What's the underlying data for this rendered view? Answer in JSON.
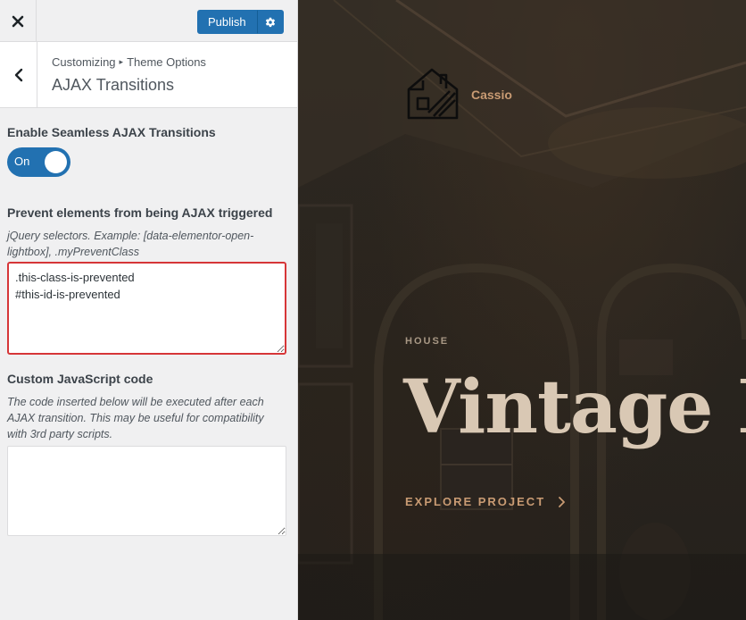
{
  "topbar": {
    "close_icon": "close-icon",
    "publish_label": "Publish",
    "settings_icon": "gear-icon"
  },
  "section": {
    "back_icon": "chevron-left-icon",
    "breadcrumb": [
      "Customizing",
      "Theme Options"
    ],
    "title": "AJAX Transitions"
  },
  "controls": {
    "enable_ajax": {
      "title": "Enable Seamless AJAX Transitions",
      "state_label": "On",
      "checked": true
    },
    "prevent": {
      "title": "Prevent elements from being AJAX triggered",
      "description": "jQuery selectors. Example: [data-elementor-open-lightbox], .myPreventClass",
      "value": ".this-class-is-prevented\n#this-id-is-prevented"
    },
    "custom_js": {
      "title": "Custom JavaScript code",
      "description": "The code inserted below will be executed after each AJAX transition. This may be useful for compatibility with 3rd party scripts.",
      "value": ""
    }
  },
  "preview": {
    "site_name": "Cassio",
    "logo_icon": "house-logo-icon",
    "kicker": "HOUSE",
    "hero_title": "Vintage R",
    "cta_label": "EXPLORE PROJECT",
    "cta_icon": "chevron-right-icon"
  },
  "colors": {
    "accent": "#2271b1",
    "highlight_border": "#d63638",
    "preview_gold": "#c99b73",
    "hero_text": "#d9c8b4"
  }
}
